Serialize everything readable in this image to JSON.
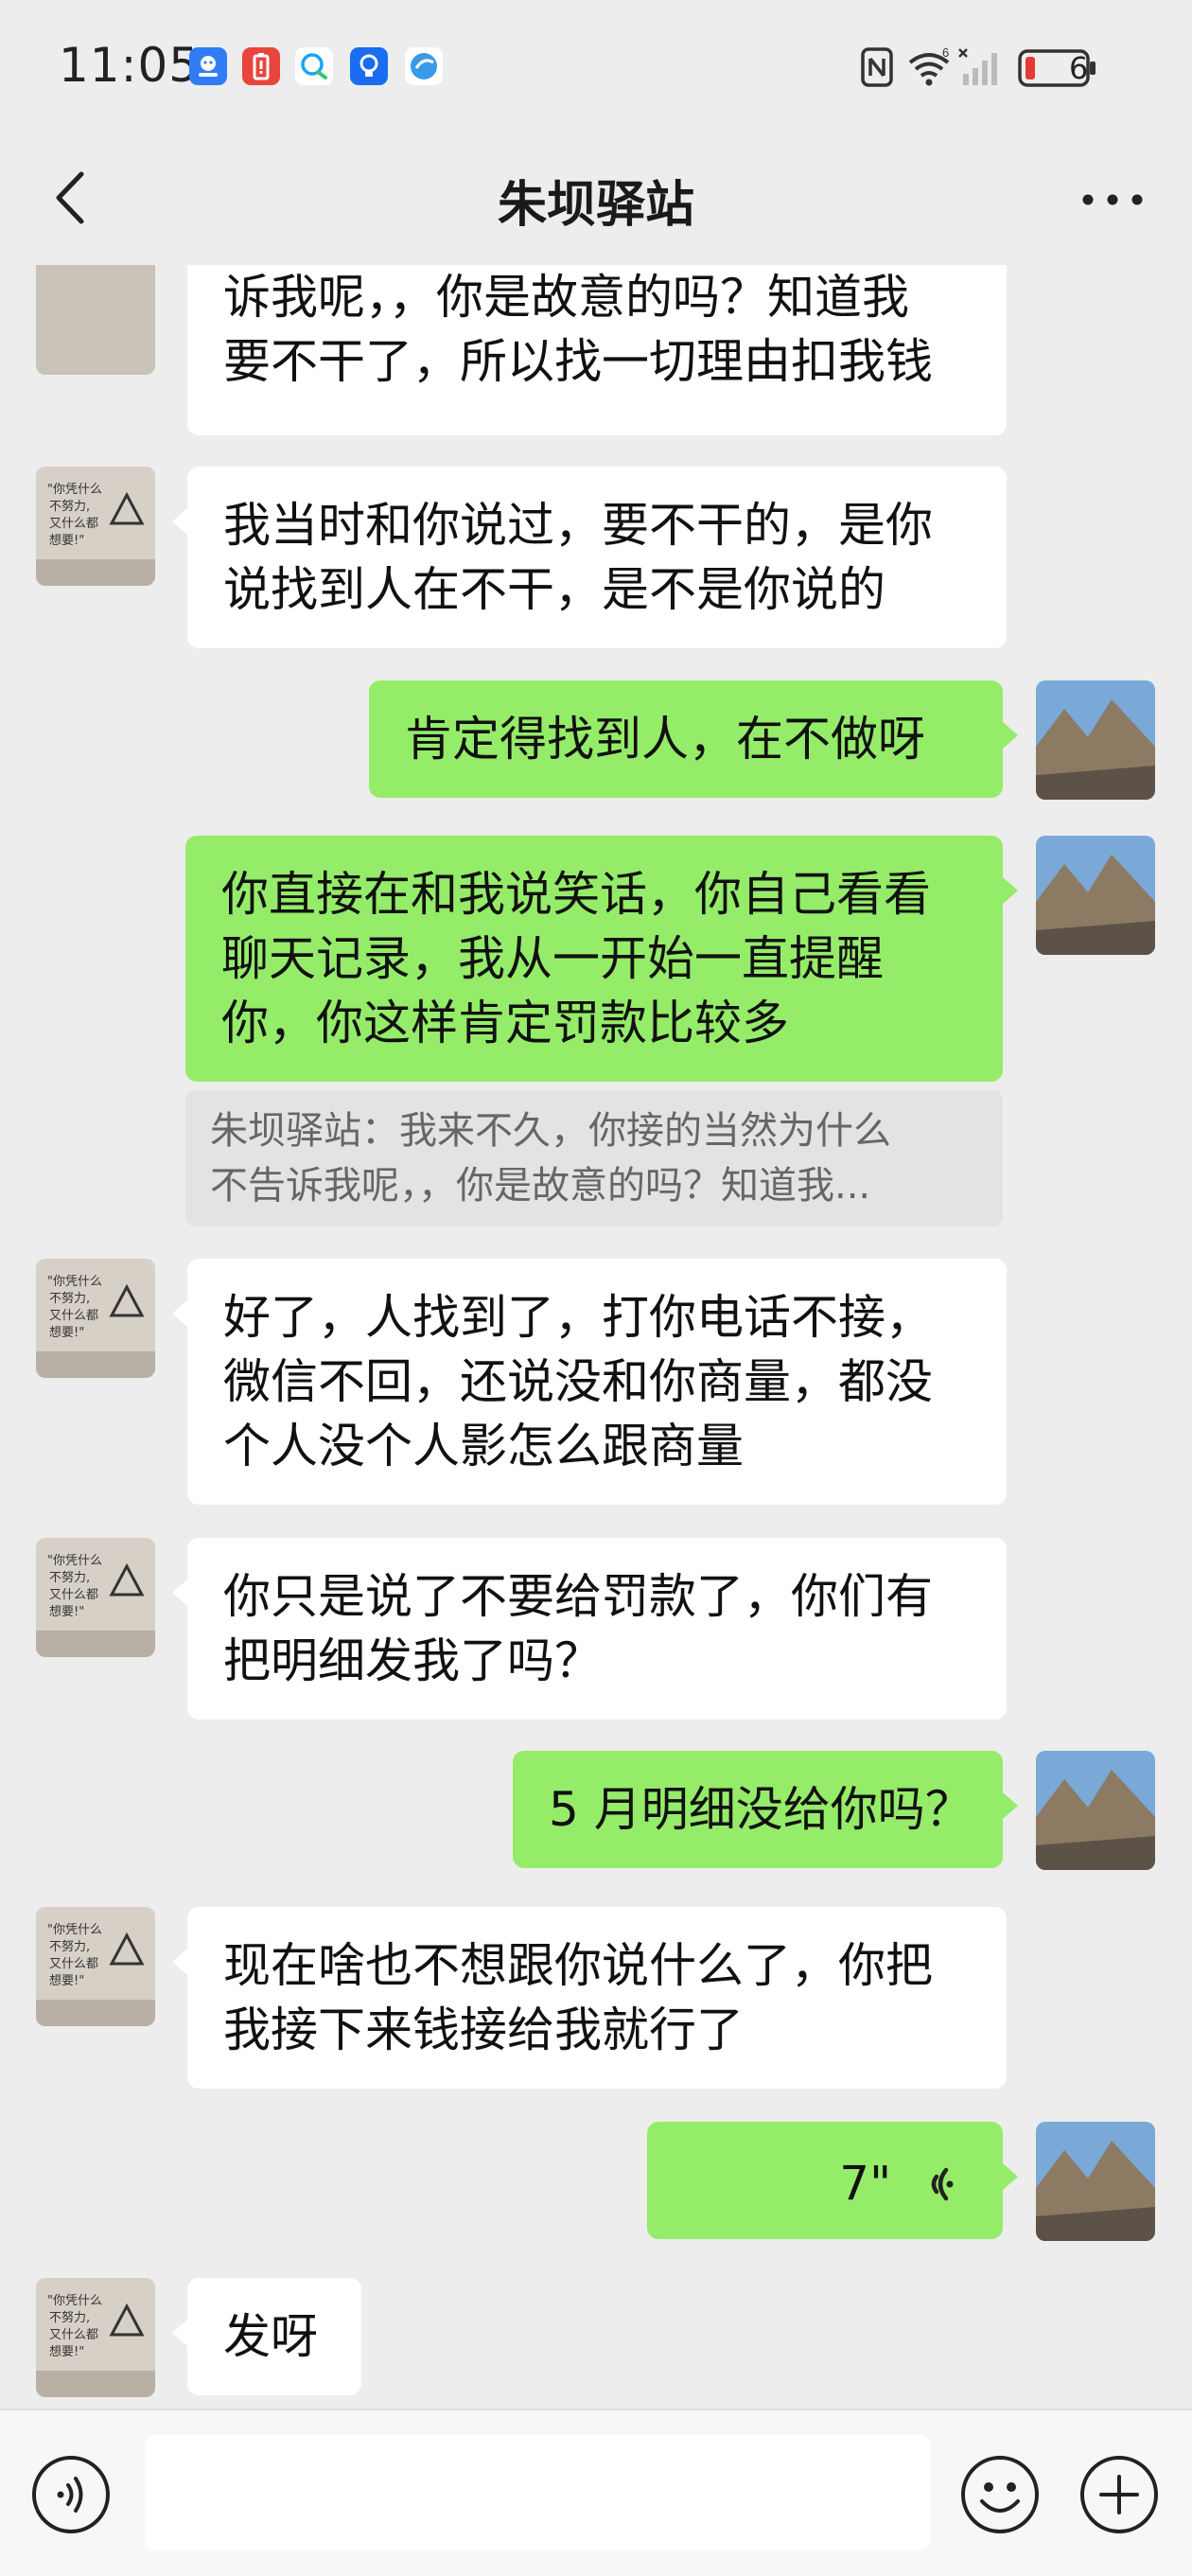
{
  "status_bar": {
    "time": "11:05",
    "battery": "6"
  },
  "header": {
    "title": "朱坝驿站"
  },
  "messages": {
    "m1": {
      "line1": "诉我呢，，你是故意的吗？知道我",
      "line2": "要不干了，所以找一切理由扣我钱"
    },
    "m2": {
      "line1": "我当时和你说过，要不干的，是你",
      "line2": "说找到人在不干，是不是你说的"
    },
    "m3": {
      "text": "肯定得找到人，在不做呀"
    },
    "m4": {
      "line1": "你直接在和我说笑话，你自己看看",
      "line2": "聊天记录，我从一开始一直提醒",
      "line3": "你，你这样肯定罚款比较多"
    },
    "quote": {
      "line1": "朱坝驿站：我来不久，你接的当然为什么",
      "line2": "不告诉我呢，，你是故意的吗？知道我..."
    },
    "m5": {
      "line1": "好了，人找到了，打你电话不接，",
      "line2": "微信不回，还说没和你商量，都没",
      "line3": "个人没个人影怎么跟商量"
    },
    "m6": {
      "line1": "你只是说了不要给罚款了，你们有",
      "line2": "把明细发我了吗？"
    },
    "m7": {
      "text": "5 月明细没给你吗？"
    },
    "m8": {
      "line1": "现在啥也不想跟你说什么了，你把",
      "line2": "我接下来钱接给我就行了"
    },
    "m9": {
      "duration": "7\""
    },
    "m10": {
      "text": "发呀"
    }
  },
  "input": {
    "placeholder": ""
  },
  "colors": {
    "outgoing": "#95ec69",
    "incoming": "#ffffff",
    "background": "#ededed"
  }
}
